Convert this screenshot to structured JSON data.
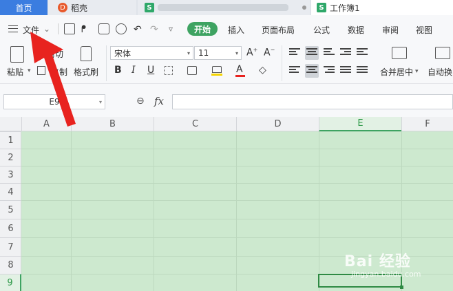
{
  "tabs": {
    "home": "首页",
    "daoke": "稻壳",
    "workbook": "工作簿1"
  },
  "menu": {
    "file": "文件",
    "start": "开始",
    "insert": "插入",
    "page_layout": "页面布局",
    "formula": "公式",
    "data": "数据",
    "review": "审阅",
    "view": "视图"
  },
  "ribbon": {
    "cut": "剪切",
    "paste": "粘贴",
    "copy": "复制",
    "format_painter": "格式刷",
    "font_name": "宋体",
    "font_size": "11",
    "merge_center": "合并居中",
    "auto_wrap": "自动换"
  },
  "formula_bar": {
    "cell_ref": "E9",
    "fx": "fx"
  },
  "grid": {
    "columns": [
      "A",
      "B",
      "C",
      "D",
      "E",
      "F"
    ],
    "rows": [
      "1",
      "2",
      "3",
      "4",
      "5",
      "6",
      "7",
      "8",
      "9"
    ],
    "selected_column": "E",
    "selected_row": "9"
  },
  "watermark": {
    "brand": "Bai 经验",
    "url": "jingyan.baidu.com"
  },
  "colors": {
    "accent_green": "#3ea362",
    "sheet_bg": "#cde9cf",
    "home_tab": "#3b7de0",
    "arrow_red": "#e8231f"
  }
}
